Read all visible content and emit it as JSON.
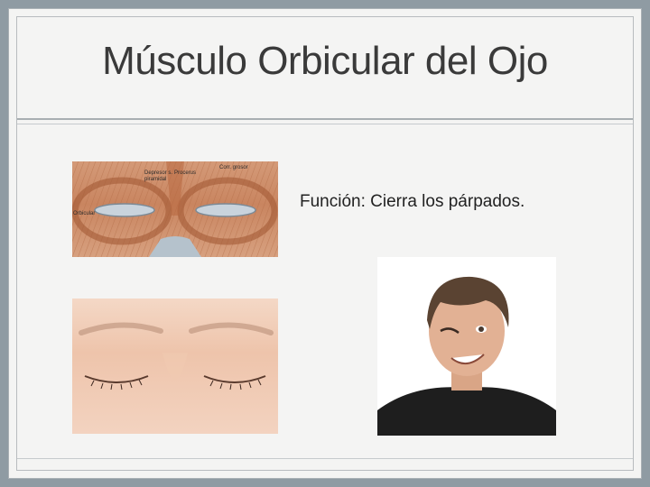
{
  "slide": {
    "title": "Músculo Orbicular del Ojo",
    "body_text": "Función: Cierra los párpados."
  },
  "images": {
    "anatomy": {
      "labels": [
        "Corr. grosor",
        "Depresor s. piramidal",
        "Procerus",
        "Orbicular"
      ]
    },
    "closed_eyes": {},
    "winking_man": {}
  }
}
